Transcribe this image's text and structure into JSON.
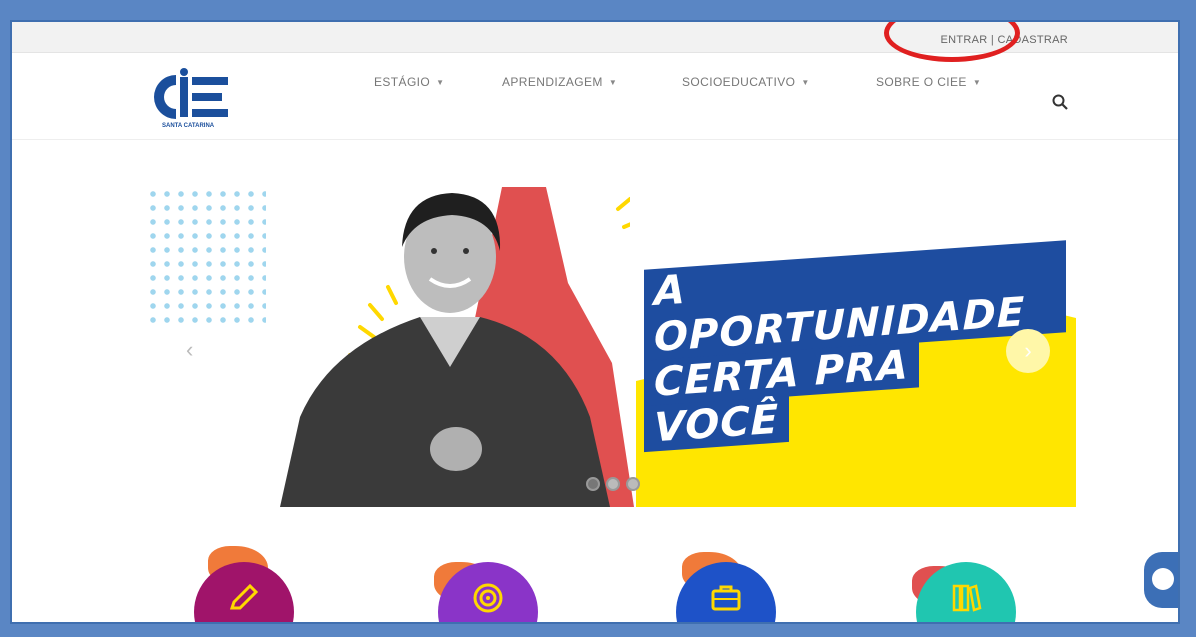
{
  "topbar": {
    "login_label": "ENTRAR",
    "separator": "|",
    "register_label": "CADASTRAR"
  },
  "header": {
    "logo_text": "CIEE",
    "logo_subtitle": "SANTA CATARINA",
    "nav": [
      {
        "label": "ESTÁGIO"
      },
      {
        "label": "APRENDIZAGEM"
      },
      {
        "label": "SOCIOEDUCATIVO"
      },
      {
        "label": "SOBRE O CIEE"
      }
    ],
    "search_icon": "search-icon"
  },
  "hero": {
    "headline_lines": [
      "A OPORTUNIDADE",
      "CERTA PRA",
      "VOCÊ"
    ],
    "slides": 3,
    "active_slide": 0
  },
  "services": [
    {
      "icon": "pencil-icon",
      "color": "#a0146a"
    },
    {
      "icon": "target-icon",
      "color": "#8a34c8"
    },
    {
      "icon": "briefcase-icon",
      "color": "#1e52c8"
    },
    {
      "icon": "books-icon",
      "color": "#20c6b0"
    }
  ],
  "colors": {
    "brand_blue": "#1e4da0",
    "accent_yellow": "#ffe600",
    "accent_red": "#e05050"
  }
}
